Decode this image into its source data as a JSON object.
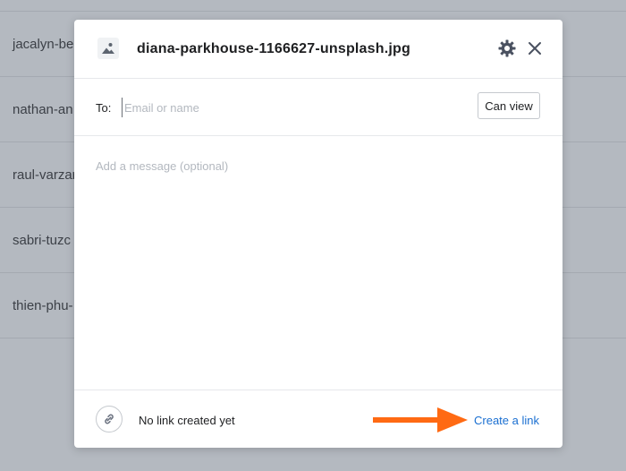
{
  "background": {
    "rows": [
      "jacalyn-be",
      "nathan-an",
      "raul-varzar",
      "sabri-tuzc",
      "thien-phu-"
    ]
  },
  "dialog": {
    "file_name": "diana-parkhouse-1166627-unsplash.jpg",
    "header_icons": {
      "file": "image-file-icon",
      "settings": "gear-icon",
      "close": "close-icon"
    },
    "to_label": "To:",
    "to_placeholder": "Email or name",
    "permission_label": "Can view",
    "message_placeholder": "Add a message (optional)",
    "link_status": "No link created yet",
    "create_link_label": "Create a link"
  },
  "colors": {
    "accent_link": "#1a6fd1",
    "annotation_arrow": "#ff6a13",
    "overlay": "#b4b9c0"
  }
}
